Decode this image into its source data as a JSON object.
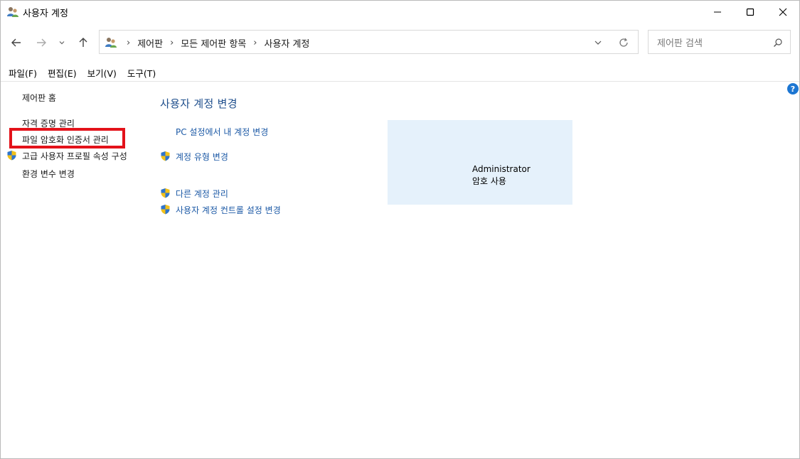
{
  "window": {
    "title": "사용자 계정"
  },
  "nav": {
    "back": "back",
    "forward": "forward",
    "recent": "recent-locations",
    "up": "up"
  },
  "address": {
    "crumbs": [
      "제어판",
      "모든 제어판 항목",
      "사용자 계정"
    ]
  },
  "search": {
    "placeholder": "제어판 검색"
  },
  "menu": {
    "items": [
      "파일(F)",
      "편집(E)",
      "보기(V)",
      "도구(T)"
    ]
  },
  "left_panel": {
    "home": "제어판 홈",
    "links": [
      "자격 증명 관리",
      "파일 암호화 인증서 관리",
      "고급 사용자 프로필 속성 구성",
      "환경 변수 변경"
    ]
  },
  "main": {
    "heading": "사용자 계정 변경",
    "tasks": [
      "PC 설정에서 내 계정 변경",
      "계정 유형 변경",
      "다른 계정 관리",
      "사용자 계정 컨트롤 설정 변경"
    ]
  },
  "account": {
    "name": "Administrator",
    "status": "암호 사용"
  },
  "help": {
    "label": "?"
  },
  "colors": {
    "link": "#1d5aa6",
    "heading": "#1e4e8c",
    "tile_bg": "#e5f1fb",
    "highlight": "#e3121a"
  }
}
